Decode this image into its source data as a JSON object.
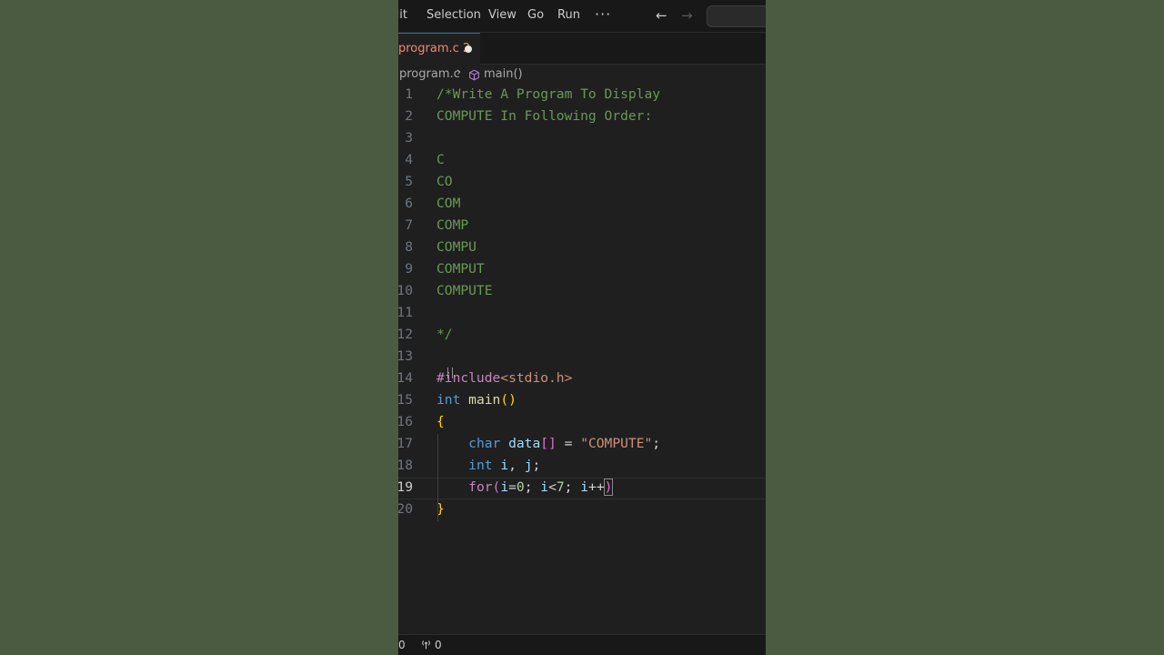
{
  "menubar": {
    "items": [
      "dit",
      "Selection",
      "View",
      "Go",
      "Run"
    ],
    "more": "···",
    "back_icon": "←",
    "forward_icon": "→"
  },
  "tab": {
    "label": "program.c 2",
    "label_color": "#f48771"
  },
  "breadcrumb": {
    "file": "program.c",
    "separator": "›",
    "symbol_icon": "cube-icon",
    "symbol": "main()"
  },
  "editor": {
    "current_line": 19,
    "lines": [
      {
        "number": "1",
        "tokens": [
          {
            "t": "/*Write A Program To Display",
            "c": "comment"
          }
        ]
      },
      {
        "number": "2",
        "tokens": [
          {
            "t": "COMPUTE In Following Order:",
            "c": "comment"
          }
        ]
      },
      {
        "number": "3",
        "tokens": []
      },
      {
        "number": "4",
        "tokens": [
          {
            "t": "C",
            "c": "comment"
          }
        ]
      },
      {
        "number": "5",
        "tokens": [
          {
            "t": "CO",
            "c": "comment"
          }
        ]
      },
      {
        "number": "6",
        "tokens": [
          {
            "t": "COM",
            "c": "comment"
          }
        ]
      },
      {
        "number": "7",
        "tokens": [
          {
            "t": "COMP",
            "c": "comment"
          }
        ]
      },
      {
        "number": "8",
        "tokens": [
          {
            "t": "COMPU",
            "c": "comment"
          }
        ]
      },
      {
        "number": "9",
        "tokens": [
          {
            "t": "COMPUT",
            "c": "comment"
          }
        ]
      },
      {
        "number": "10",
        "tokens": [
          {
            "t": "COMPUTE",
            "c": "comment"
          }
        ]
      },
      {
        "number": "11",
        "tokens": []
      },
      {
        "number": "12",
        "tokens": [
          {
            "t": "*/",
            "c": "comment"
          }
        ]
      },
      {
        "number": "13",
        "tokens": []
      },
      {
        "number": "14",
        "tokens": [
          {
            "t": "#include",
            "c": "preproc"
          },
          {
            "t": "<stdio.h>",
            "c": "include-str"
          }
        ]
      },
      {
        "number": "15",
        "tokens": [
          {
            "t": "int",
            "c": "keyword"
          },
          {
            "t": " ",
            "c": "plain"
          },
          {
            "t": "main",
            "c": "func"
          },
          {
            "t": "()",
            "c": "brace"
          }
        ]
      },
      {
        "number": "16",
        "tokens": [
          {
            "t": "{",
            "c": "brace"
          }
        ]
      },
      {
        "number": "17",
        "tokens": [
          {
            "t": "    ",
            "c": "plain"
          },
          {
            "t": "char",
            "c": "keyword"
          },
          {
            "t": " ",
            "c": "plain"
          },
          {
            "t": "data",
            "c": "var"
          },
          {
            "t": "[]",
            "c": "bracket2"
          },
          {
            "t": " = ",
            "c": "plain"
          },
          {
            "t": "\"COMPUTE\"",
            "c": "string"
          },
          {
            "t": ";",
            "c": "plain"
          }
        ]
      },
      {
        "number": "18",
        "tokens": [
          {
            "t": "    ",
            "c": "plain"
          },
          {
            "t": "int",
            "c": "keyword"
          },
          {
            "t": " ",
            "c": "plain"
          },
          {
            "t": "i",
            "c": "var"
          },
          {
            "t": ", ",
            "c": "plain"
          },
          {
            "t": "j",
            "c": "var"
          },
          {
            "t": ";",
            "c": "plain"
          }
        ]
      },
      {
        "number": "19",
        "tokens": [
          {
            "t": "    ",
            "c": "plain"
          },
          {
            "t": "for",
            "c": "flow"
          },
          {
            "t": "(",
            "c": "bracket2"
          },
          {
            "t": "i",
            "c": "var"
          },
          {
            "t": "=",
            "c": "plain"
          },
          {
            "t": "0",
            "c": "number"
          },
          {
            "t": "; ",
            "c": "plain"
          },
          {
            "t": "i",
            "c": "var"
          },
          {
            "t": "<",
            "c": "plain"
          },
          {
            "t": "7",
            "c": "number"
          },
          {
            "t": "; ",
            "c": "plain"
          },
          {
            "t": "i",
            "c": "var"
          },
          {
            "t": "++",
            "c": "plain"
          },
          {
            "t": ")",
            "c": "bracket2"
          }
        ]
      },
      {
        "number": "20",
        "tokens": [
          {
            "t": "}",
            "c": "brace"
          }
        ]
      }
    ]
  },
  "statusbar": {
    "errors": "0",
    "ports_icon": "broadcast-icon",
    "ports": "0"
  }
}
